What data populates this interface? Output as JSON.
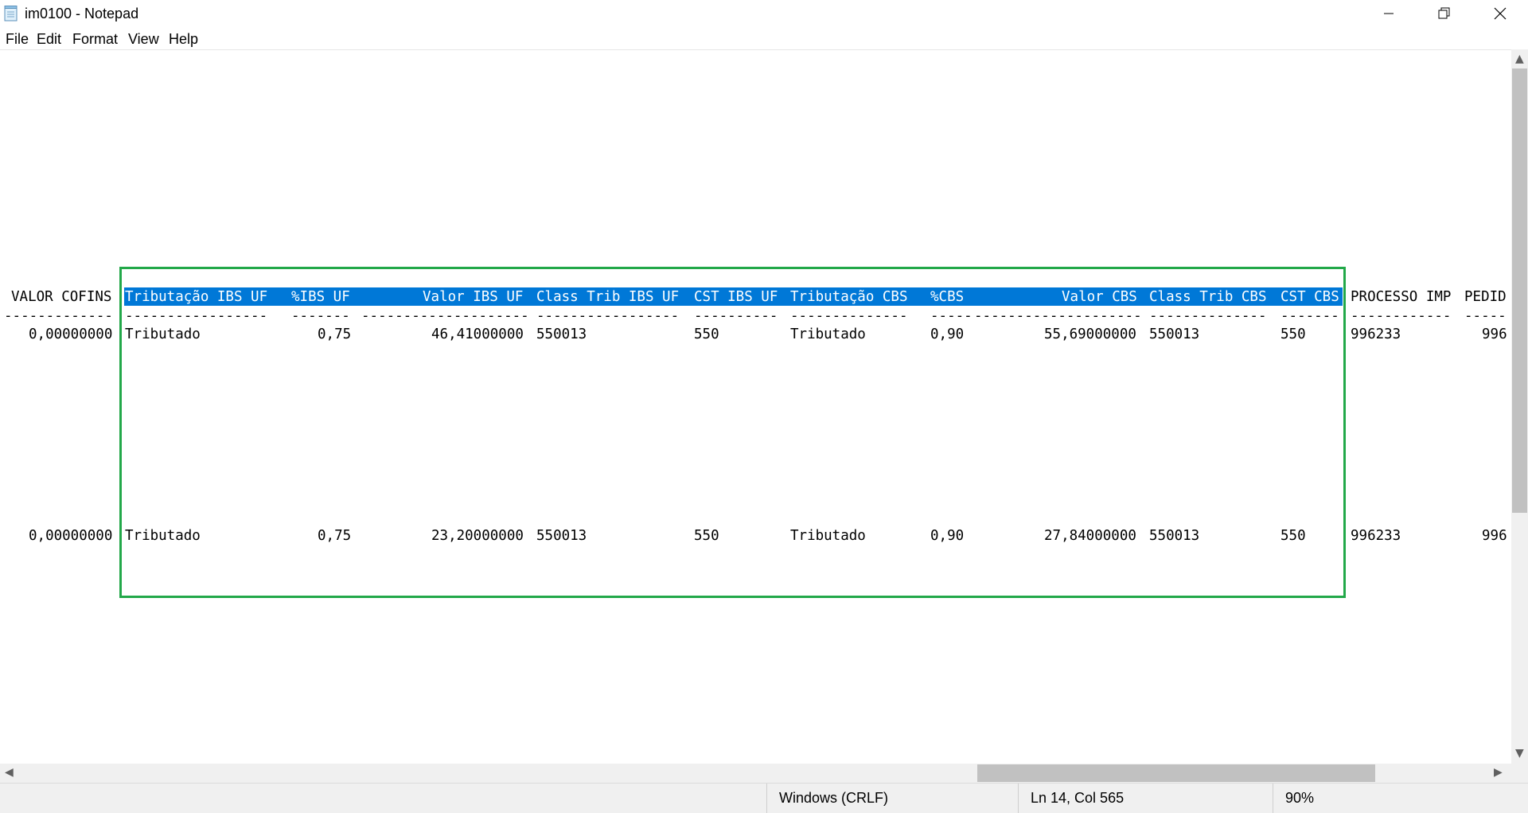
{
  "window": {
    "title": "im0100 - Notepad"
  },
  "menu": [
    "File",
    "Edit",
    "Format",
    "View",
    "Help"
  ],
  "document": {
    "header": {
      "valor_cofins": "VALOR COFINS",
      "trib_ibs_uf": "Tributação IBS UF",
      "pct_ibs_uf": "%IBS UF",
      "valor_ibs_uf": "Valor IBS UF",
      "class_trib_ibs_uf": "Class Trib IBS UF",
      "cst_ibs_uf": "CST IBS UF",
      "trib_cbs": "Tributação CBS",
      "pct_cbs": "%CBS",
      "valor_cbs": "Valor CBS",
      "class_trib_cbs": "Class Trib CBS",
      "cst_cbs": "CST CBS",
      "processo_imp": "PROCESSO IMP",
      "pedido": "PEDID"
    },
    "dashes": {
      "valor_cofins": "-------------",
      "trib_ibs_uf": "-----------------",
      "pct_ibs_uf": "-------",
      "valor_ibs_uf": "--------------------",
      "class_trib_ibs_uf": "-----------------",
      "cst_ibs_uf": "----------",
      "trib_cbs": "--------------",
      "pct_cbs": "-----",
      "valor_cbs": "--------------------",
      "class_trib_cbs": "--------------",
      "cst_cbs": "-------",
      "processo_imp": "------------",
      "pedido": "-----"
    },
    "rows": [
      {
        "valor_cofins": "0,00000000",
        "trib_ibs_uf": "Tributado",
        "pct_ibs_uf": "0,75",
        "valor_ibs_uf": "46,41000000",
        "class_trib_ibs_uf": "550013",
        "cst_ibs_uf": "550",
        "trib_cbs": "Tributado",
        "pct_cbs": "0,90",
        "valor_cbs": "55,69000000",
        "class_trib_cbs": "550013",
        "cst_cbs": "550",
        "processo_imp": "996233",
        "pedido": "996"
      },
      {
        "valor_cofins": "0,00000000",
        "trib_ibs_uf": "Tributado",
        "pct_ibs_uf": "0,75",
        "valor_ibs_uf": "23,20000000",
        "class_trib_ibs_uf": "550013",
        "cst_ibs_uf": "550",
        "trib_cbs": "Tributado",
        "pct_cbs": "0,90",
        "valor_cbs": "27,84000000",
        "class_trib_cbs": "550013",
        "cst_cbs": "550",
        "processo_imp": "996233",
        "pedido": "996"
      }
    ]
  },
  "status": {
    "line_ending": "Windows (CRLF)",
    "position": "Ln 14, Col 565",
    "zoom": "90%"
  },
  "colors": {
    "selection": "#0078d7",
    "annotation_box": "#22a849"
  },
  "icons": [
    "notepad-icon",
    "minimize-icon",
    "restore-icon",
    "close-icon",
    "scroll-up-icon",
    "scroll-down-icon",
    "scroll-left-icon",
    "scroll-right-icon"
  ]
}
